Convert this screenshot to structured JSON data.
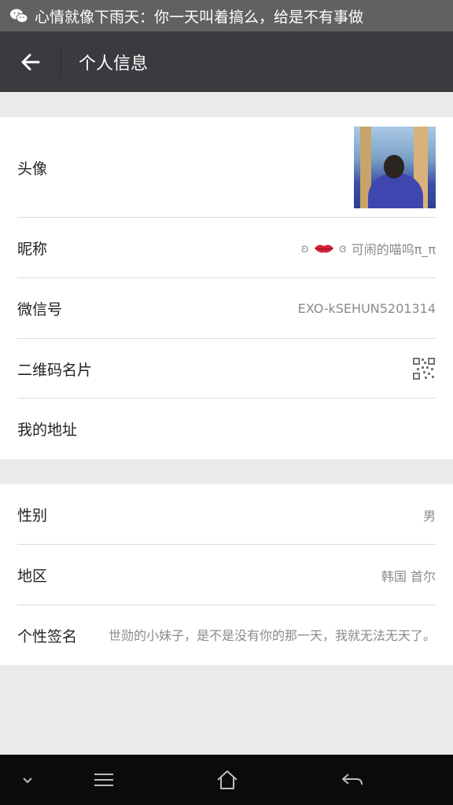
{
  "status_bar": {
    "app_icon": "wechat-icon",
    "notification_text": "心情就像下雨天：你一天叫着搞么，给是不有事做"
  },
  "header": {
    "back_icon": "arrow-left-icon",
    "title": "个人信息"
  },
  "profile": {
    "avatar_label": "头像",
    "nickname_label": "昵称",
    "nickname_value": "可闹的喵呜π_π",
    "wechat_id_label": "微信号",
    "wechat_id_value": "EXO-kSEHUN5201314",
    "qrcode_label": "二维码名片",
    "address_label": "我的地址"
  },
  "details": {
    "gender_label": "性别",
    "gender_value": "男",
    "region_label": "地区",
    "region_value": "韩国 首尔",
    "signature_label": "个性签名",
    "signature_value": "世勋的小妹子，是不是没有你的那一天，我就无法无天了。"
  },
  "nav_bar": {
    "icons": [
      "chevron-down-icon",
      "menu-icon",
      "home-icon",
      "back-icon"
    ]
  },
  "colors": {
    "status_bar": "#616161",
    "title_bar": "#3a3a3f",
    "background": "#ebebeb"
  }
}
